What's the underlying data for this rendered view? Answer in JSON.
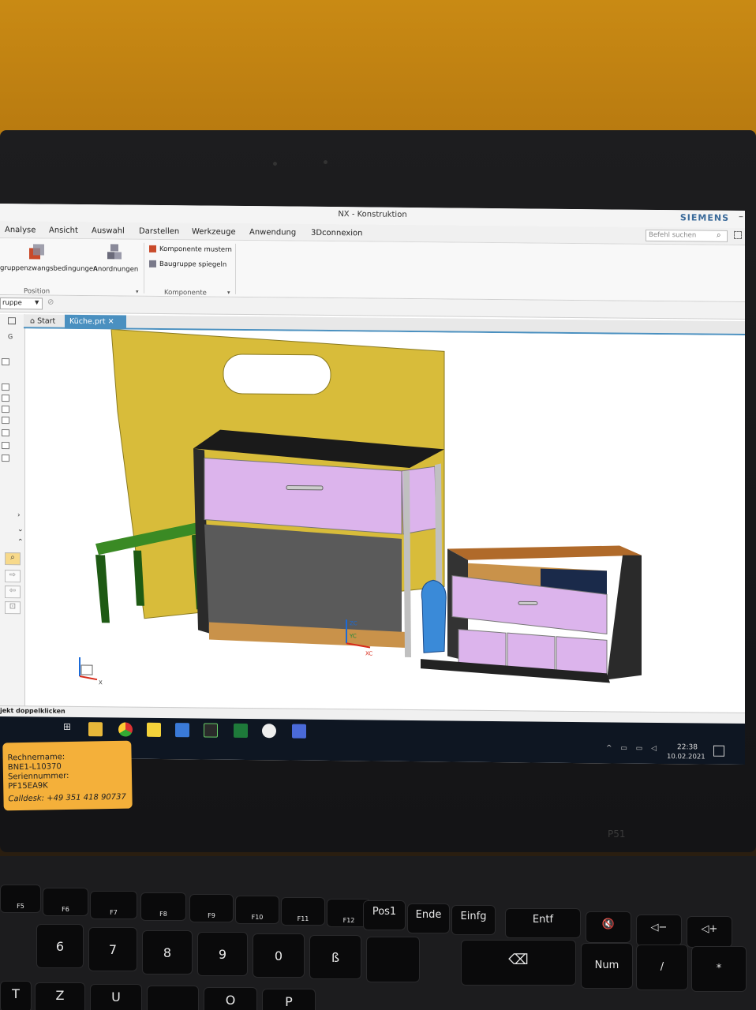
{
  "window": {
    "title": "NX - Konstruktion",
    "brand": "SIEMENS",
    "minimize": "–"
  },
  "menu": [
    "Analyse",
    "Ansicht",
    "Auswahl",
    "Darstellen",
    "Werkzeuge",
    "Anwendung",
    "3Dconnexion"
  ],
  "search": {
    "placeholder": "Befehl suchen"
  },
  "ribbon": {
    "btn1": "gruppenzwangsbedingungen",
    "btn2": "Anordnungen",
    "btn3": "Komponente mustern",
    "btn4": "Baugruppe spiegeln",
    "group1": "Position",
    "group2": "Komponente"
  },
  "filter": {
    "value": "ruppe"
  },
  "tabs": {
    "start": "Start",
    "kueche": "Küche.prt"
  },
  "status": {
    "text": "jekt doppelklicken"
  },
  "axes": {
    "yc": "YC",
    "xc": "XC",
    "zc": "ZC",
    "x": "X"
  },
  "clock": {
    "time": "22:38",
    "date": "10.02.2021"
  },
  "sticker": {
    "l1": "Rechnername:",
    "l2": "BNE1-L10370",
    "l3": "Seriennummer:",
    "l4": "PF15EA9K",
    "l5": "Calldesk: +49 351 418 90737"
  },
  "laptop_badge": "P51",
  "keys": {
    "f5": "F5",
    "f6": "F6",
    "f7": "F7",
    "f8": "F8",
    "f9": "F9",
    "f10": "F10",
    "f11": "F11",
    "f12": "F12",
    "pos1": "Pos1",
    "ende": "Ende",
    "einfg": "Einfg",
    "entf": "Entf",
    "k6": "6",
    "k7": "7",
    "k8": "8",
    "k9": "9",
    "k0": "0",
    "ss": "ß",
    "num": "Num",
    "slash": "/",
    "star": "*",
    "z": "Z",
    "u": "U",
    "t": "T",
    "o": "O",
    "p": "P"
  },
  "colors": {
    "wall": "#c98a14",
    "panel_yellow": "#d8bc3a",
    "bench_green": "#2e7a1c",
    "drawer_purple": "#dcb4ec",
    "cabinet_dark": "#2a2a2a",
    "wood": "#c9924a",
    "accent_tab": "#4a90c0",
    "sticker": "#f4b03a"
  },
  "icons": [
    "search-icon",
    "home-icon",
    "close-icon",
    "windows-icon",
    "chrome-icon",
    "excel-icon",
    "calculator-icon",
    "lock-icon"
  ]
}
